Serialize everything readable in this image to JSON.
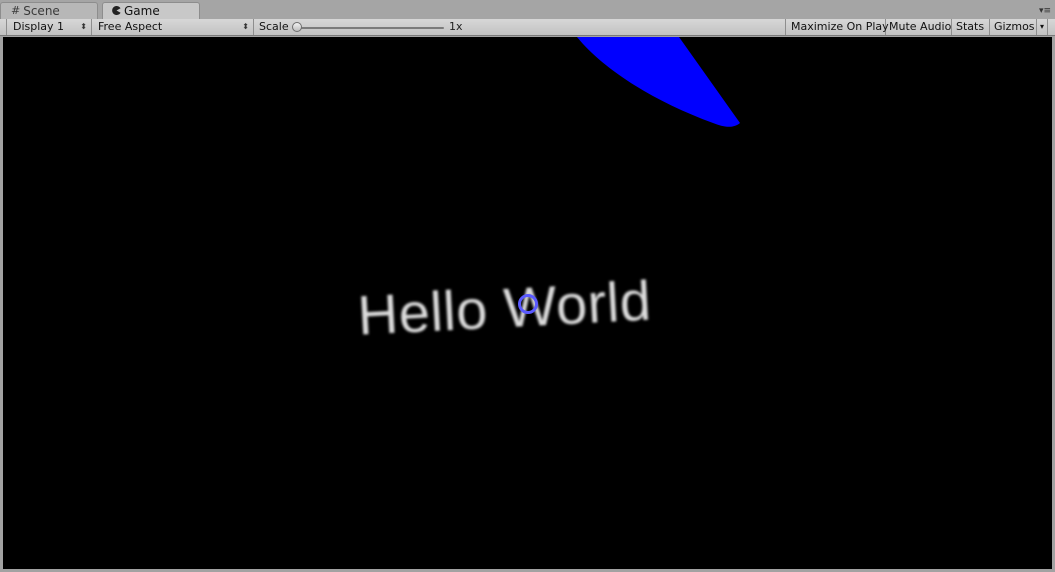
{
  "tabs": {
    "scene_label": "Scene",
    "game_label": "Game",
    "scene_icon": "grid-icon",
    "game_icon": "pacman-icon"
  },
  "toolbar": {
    "display_value": "Display 1",
    "aspect_value": "Free Aspect",
    "scale_label": "Scale",
    "scale_value": "1x",
    "maximize_label": "Maximize On Play",
    "mute_label": "Mute Audio",
    "stats_label": "Stats",
    "gizmos_label": "Gizmos"
  },
  "game_view": {
    "text": "Hello World",
    "text_color": "#dcdcdc",
    "shape_color": "#0000ff",
    "pivot_color": "#5a5aff",
    "background": "#000000"
  }
}
